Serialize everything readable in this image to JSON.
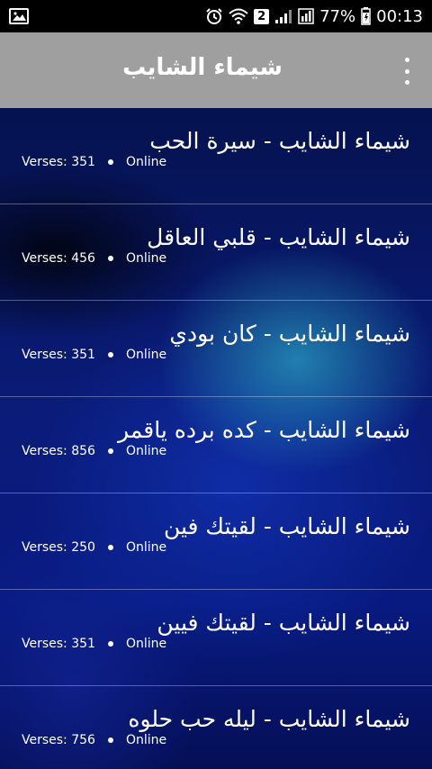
{
  "status_bar": {
    "battery_percent": "77%",
    "time": "00:13",
    "notification_count": "2",
    "icons": [
      "gallery-icon",
      "alarm-icon",
      "wifi-icon",
      "sim-icon",
      "signal-icon",
      "battery-icon"
    ]
  },
  "toolbar": {
    "title": "شيماء الشايب",
    "overflow_icon": "overflow-menu-icon",
    "background": "#9f9f9f"
  },
  "songs": [
    {
      "title": "شيماء الشايب - سيرة الحب",
      "verses": "Verses: 351",
      "status": "Online"
    },
    {
      "title": "شيماء الشايب - قلبي العاقل",
      "verses": "Verses: 456",
      "status": "Online"
    },
    {
      "title": "شيماء الشايب - كان بودي",
      "verses": "Verses: 351",
      "status": "Online"
    },
    {
      "title": "شيماء الشايب - كده برده ياقمر",
      "verses": "Verses: 856",
      "status": "Online"
    },
    {
      "title": "شيماء الشايب - لقيتك فين",
      "verses": "Verses: 250",
      "status": "Online"
    },
    {
      "title": "شيماء الشايب - لقيتك فيين",
      "verses": "Verses: 351",
      "status": "Online"
    },
    {
      "title": "شيماء الشايب - ليله حب حلوه",
      "verses": "Verses: 756",
      "status": "Online"
    }
  ]
}
